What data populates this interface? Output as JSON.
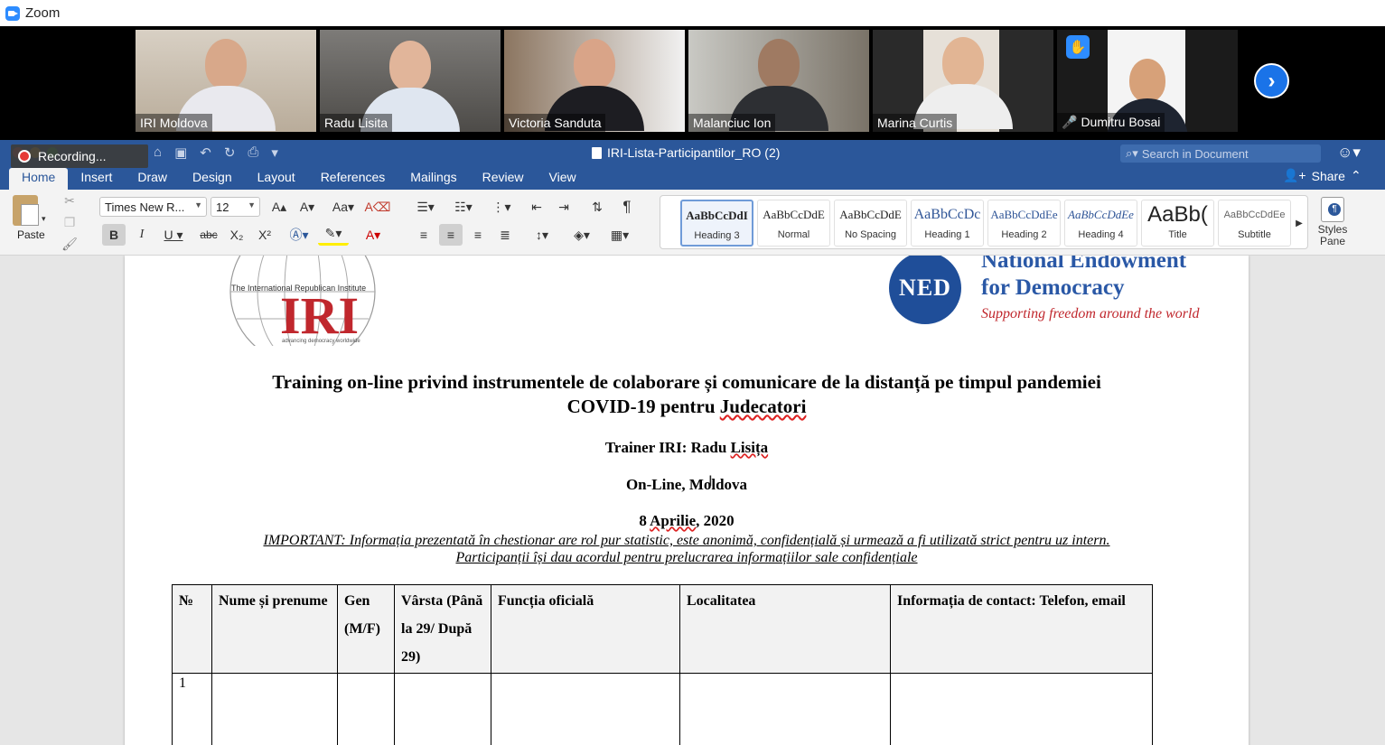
{
  "zoom": {
    "title": "Zoom"
  },
  "video_tiles": [
    {
      "name": "IRI Moldova",
      "muted": false,
      "active": false
    },
    {
      "name": "Radu Lisita",
      "muted": false,
      "active": false
    },
    {
      "name": "Victoria Sanduta",
      "muted": false,
      "active": false
    },
    {
      "name": "Malanciuc Ion",
      "muted": false,
      "active": false
    },
    {
      "name": "Marina Curtis",
      "muted": false,
      "active": true
    },
    {
      "name": "Dumitru Bosai",
      "muted": true,
      "active": false,
      "hand_raised": true
    }
  ],
  "recording": {
    "label": "Recording..."
  },
  "word": {
    "doc_title": "IRI-Lista-Participantilor_RO (2)",
    "search_placeholder": "Search in Document",
    "tabs": [
      "Home",
      "Insert",
      "Draw",
      "Design",
      "Layout",
      "References",
      "Mailings",
      "Review",
      "View"
    ],
    "active_tab": "Home",
    "share_label": "Share"
  },
  "ribbon": {
    "paste_label": "Paste",
    "font_name": "Times New R...",
    "font_size": "12",
    "styles": [
      {
        "sample": "AaBbCcDdI",
        "name": "Heading 3",
        "selected": true
      },
      {
        "sample": "AaBbCcDdE",
        "name": "Normal",
        "selected": false
      },
      {
        "sample": "AaBbCcDdE",
        "name": "No Spacing",
        "selected": false
      },
      {
        "sample": "AaBbCcDc",
        "name": "Heading 1",
        "selected": false
      },
      {
        "sample": "AaBbCcDdEe",
        "name": "Heading 2",
        "selected": false
      },
      {
        "sample": "AaBbCcDdEe",
        "name": "Heading 4",
        "selected": false
      },
      {
        "sample": "AaBb(",
        "name": "Title",
        "selected": false
      },
      {
        "sample": "AaBbCcDdEe",
        "name": "Subtitle",
        "selected": false
      }
    ],
    "styles_pane_label": "Styles Pane"
  },
  "document": {
    "iri_logo": {
      "small": "The International Republican Institute",
      "big": "IRI",
      "tagline": "advancing democracy worldwide"
    },
    "ned_logo": {
      "circle": "NED",
      "line1": "National Endowment",
      "line2": "for Democracy",
      "line3": "Supporting freedom around the world"
    },
    "title_line1": "Training on-line privind instrumentele de colaborare și comunicare de la distanță pe timpul pandemiei",
    "title_line2_prefix": "COVID-19 pentru ",
    "title_line2_word": "Judecatori",
    "trainer_prefix": "Trainer IRI: Radu ",
    "trainer_name": "Lisița",
    "location": "On-Line, Moldova",
    "date_prefix": "8 ",
    "date_month": "Aprilie",
    "date_suffix": ", 2020",
    "important_line1": "IMPORTANT: Informația prezentată în chestionar are rol pur statistic, este anonimă, confidențială și urmează a fi utilizată strict pentru uz intern.",
    "important_line2": "Participanții își dau acordul pentru prelucrarea informațiilor sale confidențiale",
    "table": {
      "headers": [
        "№",
        "Nume și prenume",
        "Gen (M/F)",
        "Vârsta (Până la 29/ După 29)",
        "Funcția oficială",
        "Localitatea",
        "Informația de contact: Telefon,  email"
      ],
      "rows": [
        [
          "1",
          "",
          "",
          "",
          "",
          "",
          ""
        ]
      ]
    }
  }
}
